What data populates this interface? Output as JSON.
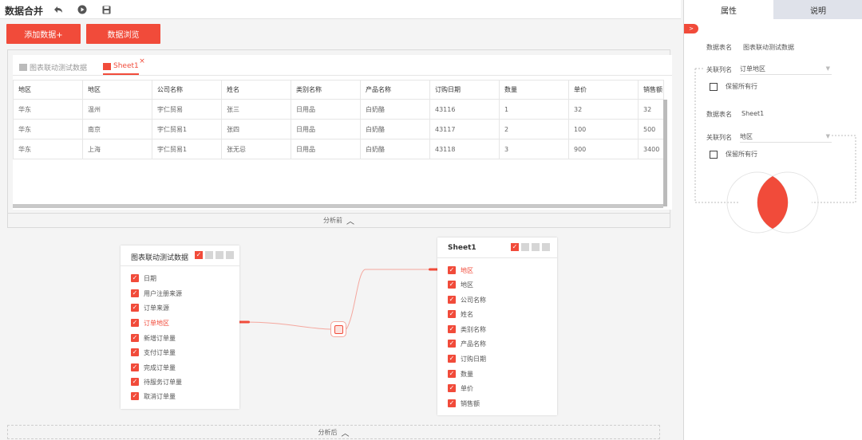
{
  "app": {
    "title": "数据合并"
  },
  "toolbar": {
    "undo_icon": "undo-icon",
    "run_icon": "run-icon",
    "save_icon": "save-icon"
  },
  "buttons": {
    "add_data": "添加数据+",
    "browse_data": "数据浏览"
  },
  "preview": {
    "tabs": [
      {
        "label": "图表联动测试数据",
        "icon": "sheet-icon",
        "active": false
      },
      {
        "label": "Sheet1",
        "icon": "sheet-icon",
        "active": true,
        "close": "×"
      }
    ],
    "columns": [
      "地区",
      "地区",
      "公司名称",
      "姓名",
      "类别名称",
      "产品名称",
      "订购日期",
      "数量",
      "单价",
      "销售额"
    ],
    "rows": [
      [
        "华东",
        "温州",
        "宇仁贸易",
        "张三",
        "日用品",
        "白奶酪",
        "43116",
        "1",
        "32",
        "32"
      ],
      [
        "华东",
        "南京",
        "宇仁贸易1",
        "张四",
        "日用品",
        "白奶酪",
        "43117",
        "2",
        "100",
        "500"
      ],
      [
        "华东",
        "上海",
        "宇仁贸易1",
        "张无忌",
        "日用品",
        "白奶酪",
        "43118",
        "3",
        "900",
        "3400"
      ]
    ],
    "collapse_label": "分析前"
  },
  "flow": {
    "left_node": {
      "title": "图表联动测试数据",
      "fields": [
        "日期",
        "用户注册来源",
        "订单来源",
        "订单地区",
        "新增订单量",
        "支付订单量",
        "完成订单量",
        "待服务订单量",
        "取消订单量"
      ],
      "highlight_index": 3
    },
    "right_node": {
      "title": "Sheet1",
      "fields": [
        "地区",
        "地区",
        "公司名称",
        "姓名",
        "类别名称",
        "产品名称",
        "订购日期",
        "数量",
        "单价",
        "销售额"
      ],
      "highlight_index": 0
    },
    "collapse_label": "分析后"
  },
  "side": {
    "tabs": [
      {
        "label": "属性",
        "active": true
      },
      {
        "label": "说明",
        "active": false
      }
    ],
    "toggle": ">",
    "table1": {
      "label": "数据表名",
      "value": "图表联动测试数据",
      "key_label": "关联列名",
      "key_value": "订单地区",
      "keep_label": "保留所有行"
    },
    "table2": {
      "label": "数据表名",
      "value": "Sheet1",
      "key_label": "关联列名",
      "key_value": "地区",
      "keep_label": "保留所有行"
    },
    "join_type": "inner"
  },
  "colors": {
    "accent": "#f14b3a",
    "venn_fill": "#f14b3a"
  }
}
